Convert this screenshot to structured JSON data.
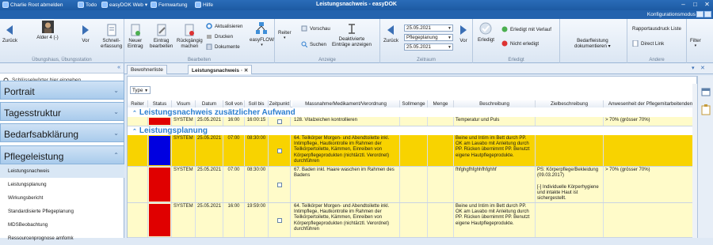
{
  "titlebar": {
    "user": "Charlie Root abmelden",
    "todo": "Todo",
    "easydok_web": "easyDOK Web",
    "fernwartung": "Fernwartung",
    "hilfe": "Hilfe",
    "title": "Leistungsnachweis - easyDOK"
  },
  "konfig": {
    "label": "Konfigurationsmodus"
  },
  "ribbon": {
    "zurueck": "Zurück",
    "bewohner": "Alder 4 (-)",
    "vor": "Vor",
    "schnell": "Schnell-\nerfassung",
    "group_uebung": "Übungshaus, Übungsstation",
    "neuer": "Neuer\nEintrag",
    "bearbeiten": "Eintrag\nbearbeiten",
    "rueck": "Rückgängig\nmachen",
    "aktualisieren": "Aktualisieren",
    "drucken": "Drucken",
    "dokumente": "Dokumente",
    "easyflow": "easyFLOW",
    "group_bearbeiten": "Bearbeiten",
    "reiter": "Reiter",
    "vorschau": "Vorschau",
    "suchen": "Suchen",
    "deaktiv": "Deaktivierte\nEinträge anzeigen",
    "group_anzeige": "Anzeige",
    "zeit_zurueck": "Zurück",
    "date_from": "25.05.2021",
    "planung": "Pflegeplanung",
    "date_to": "25.05.2021",
    "zeit_vor": "Vor",
    "group_zeitraum": "Zeitraum",
    "erledigt": "Erledigt",
    "erledigt_verlauf": "Erledigt mit Verlauf",
    "nicht_erledigt": "Nicht erledigt",
    "group_erledigt": "Erledigt",
    "bedarf": "Bedarfleistung\ndokumentieren",
    "group_bedarf": "",
    "rapport": "Rapportausdruck Liste",
    "direct": "Direct Link",
    "group_andere": "Andere",
    "filter": "Filter"
  },
  "sidebar": {
    "search": "Schlüsselwörter hier eingeben",
    "cats": [
      "Portrait",
      "Tagesstruktur",
      "Bedarfsabklärung",
      "Pflegeleistung"
    ],
    "subs": [
      "Leistungsnachweis",
      "Leistungsplanung",
      "Wirkungsbericht",
      "Standardisierte Pflegeplanung",
      "MDSBeobachtung",
      "Ressourcenprognose amfomk"
    ]
  },
  "tabs": [
    "Bewohnerliste",
    "Leistungsnachweis"
  ],
  "grid": {
    "type_label": "Type",
    "headers": [
      "Reiter",
      "Status",
      "Visum",
      "Datum",
      "Soll von",
      "Soll bis",
      "Zeitpunkt",
      "Massnahme/Medikament/Verordnung",
      "Sollmenge",
      "Menge",
      "Beschreibung",
      "Zielbeschreibung",
      "Anwesenheit der Pflegemitarbeitenden"
    ],
    "group1": "Leistungsnachweis zusätzlicher Aufwand",
    "group2": "Leistungsplanung",
    "rows": [
      {
        "visum": "SYSTEM",
        "datum": "25.05.2021",
        "von": "16:00",
        "bis": "16:00:15",
        "mass": "128. Vitalzeichen kontrollieren",
        "beschr": "Temperatur und Puls",
        "ziel": "",
        "anw": "> 70% (grösser 70%)",
        "status": "#e00000",
        "bg": "#fffbc9"
      },
      {
        "visum": "SYSTEM",
        "datum": "25.05.2021",
        "von": "07:00",
        "bis": "08:30:00",
        "mass": "64. Teilkörper Morgen- und Abendtoilette inkl. Intimpflege, Hautkontrolle im Rahmen der Teilkörpertoilette, Kämmen, Einreiben von Körperpflegeprodukten (nichtärztl. Verordnet) durchführen",
        "beschr": "Beine und Intim im Bett durch PP. OK am Lavabo mit Anleitung durch PP. Rücken übernimmt PP. Benutzt eigene Hautpflegeprodukte.",
        "ziel": "",
        "anw": "",
        "status": "#0000e0",
        "bg": "#f8d300"
      },
      {
        "visum": "SYSTEM",
        "datum": "25.05.2021",
        "von": "07:00",
        "bis": "08:30:00",
        "mass": "67. Baden inkl. Haare waschen im Rahmen des Badens",
        "beschr": "fhfghgfhfghhfhfghhf",
        "ziel": "PS: Körperpflege/Bekleidung (09.03.2017)\n\n[-] Individuelle Körperhygiene und intakte Haut ist sichergestellt.",
        "anw": "> 70% (grösser 70%)",
        "status": "#e00000",
        "bg": "#fffbc9"
      },
      {
        "visum": "SYSTEM",
        "datum": "25.05.2021",
        "von": "16:00",
        "bis": "19:59:00",
        "mass": "64. Teilkörper Morgen- und Abendtoilette inkl. Intimpflege, Hautkontrolle im Rahmen der Teilkörpertoilette, Kämmen, Einreiben von Körperpflegeprodukten (nichtärztl. Verordnet) durchführen",
        "beschr": "Beine und Intim im Bett durch PP. OK am Lavabo mit Anleitung durch PP. Rücken übernimmt PP. Benutzt eigene Hautpflegeprodukte.",
        "ziel": "",
        "anw": "",
        "status": "#e00000",
        "bg": "#fffbc9"
      }
    ]
  },
  "colors": {
    "accent": "#2d7fd0",
    "title_bg": "#1d5aa3"
  }
}
